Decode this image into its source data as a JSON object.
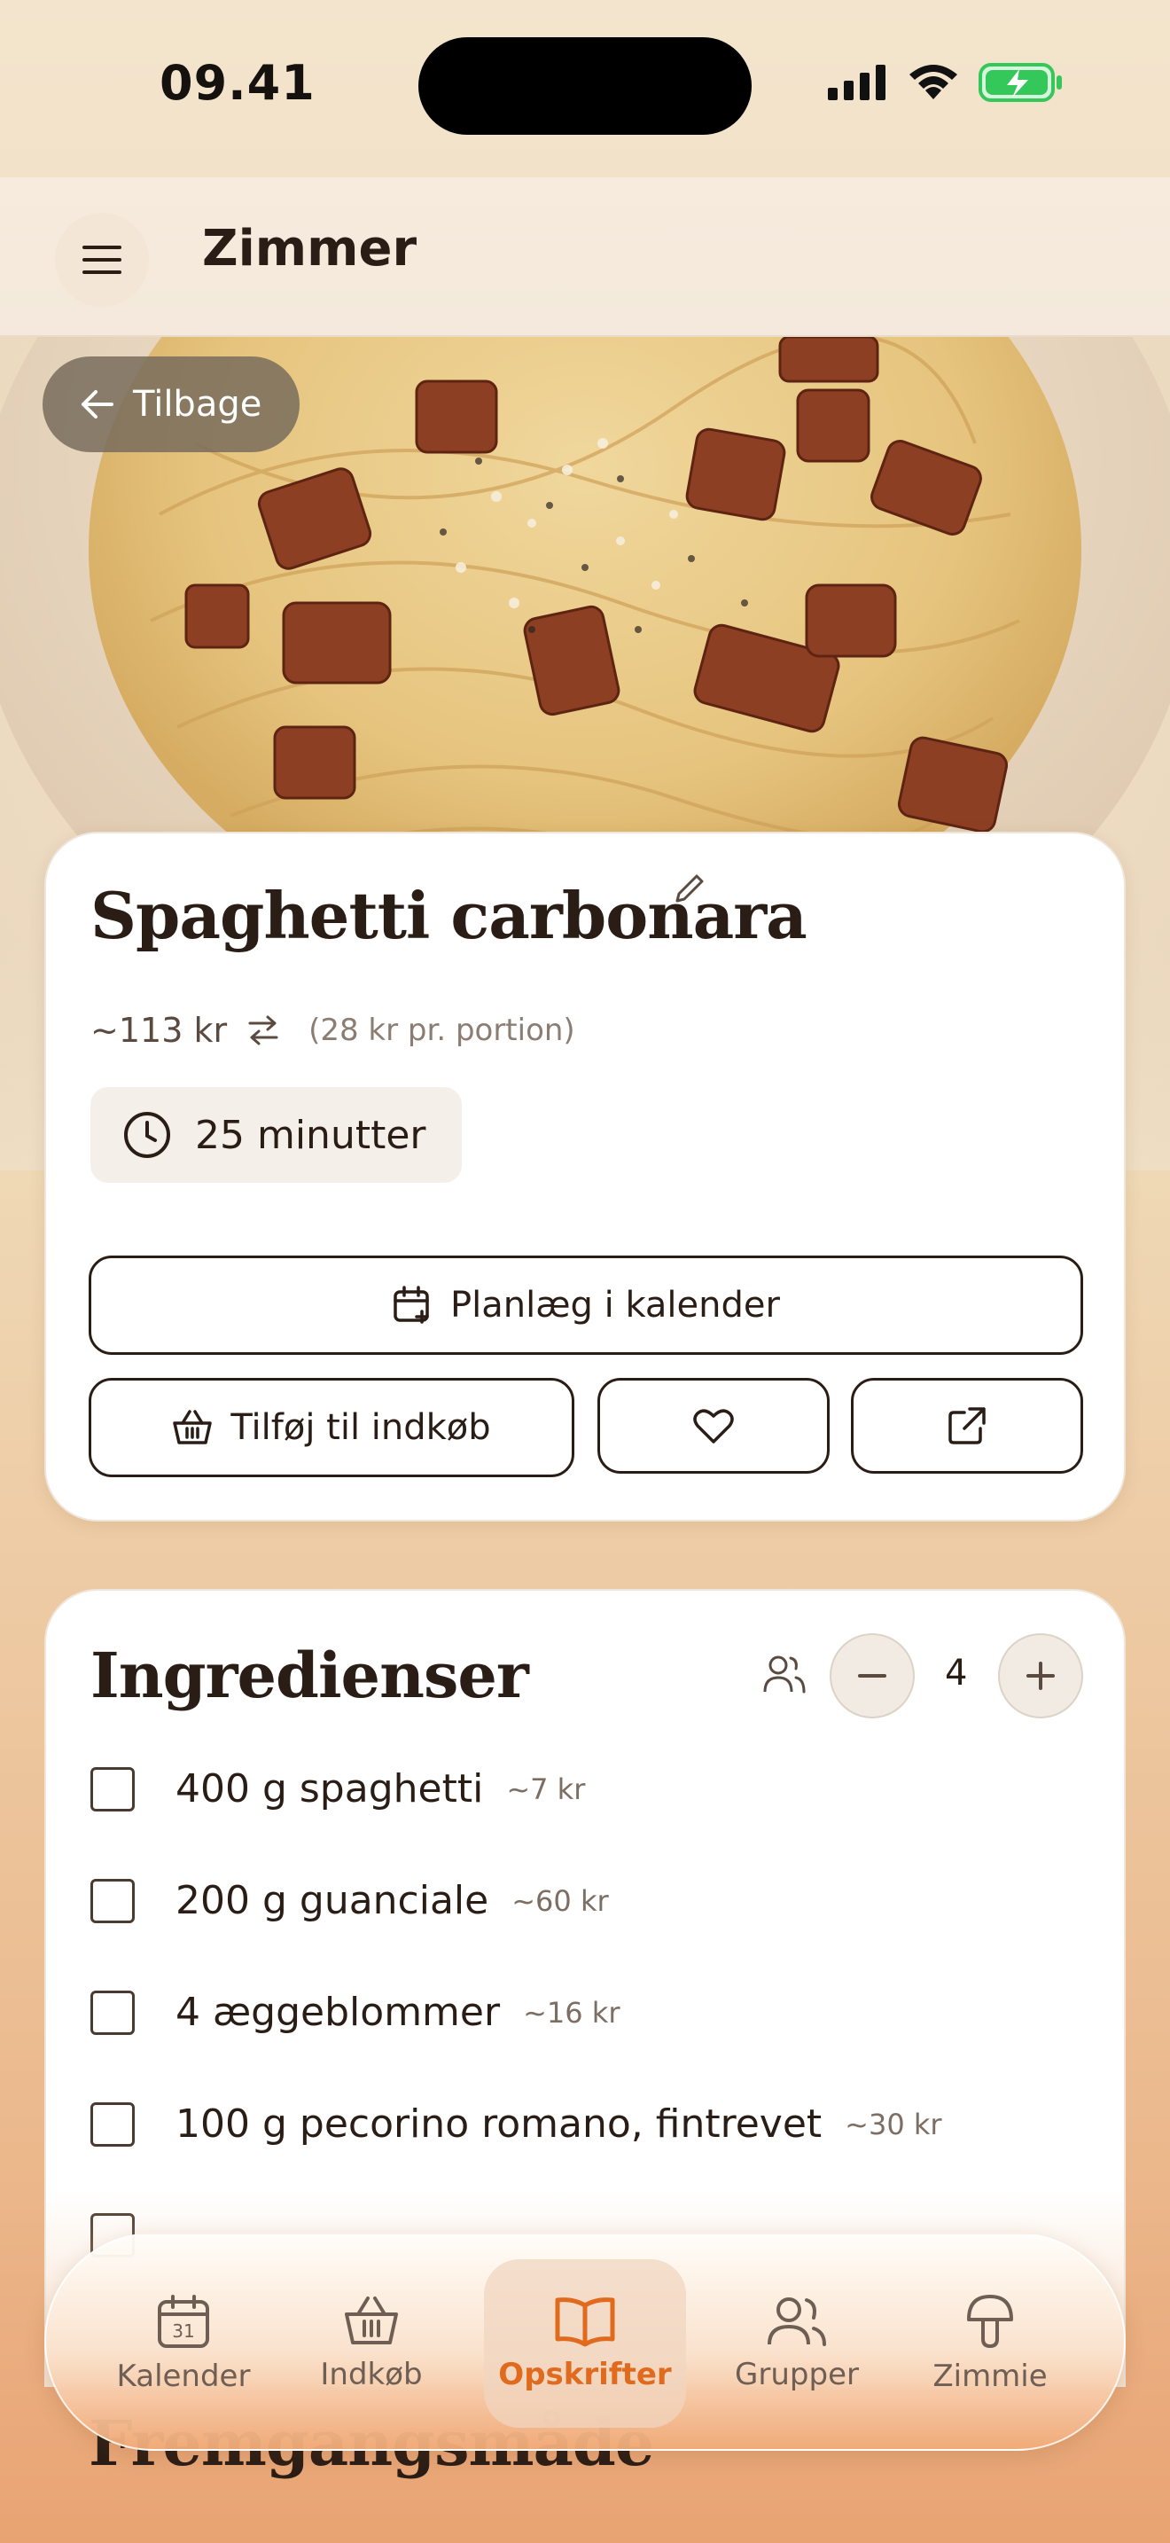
{
  "status_bar": {
    "time": "09.41"
  },
  "header": {
    "title": "Zimmer",
    "menu_icon": "hamburger-icon"
  },
  "hero": {
    "image": "spaghetti-carbonara-photo",
    "back_label": "Tilbage"
  },
  "recipe": {
    "title": "Spaghetti carbonara",
    "price": "~113 kr",
    "per_portion": "(28 kr pr. portion)",
    "time": "25 minutter",
    "plan_label": "Planlæg i kalender",
    "shop_label": "Tilføj til indkøb"
  },
  "ingredients": {
    "title": "Ingredienser",
    "servings": "4",
    "items": [
      {
        "name": "400 g spaghetti",
        "price": "~7 kr"
      },
      {
        "name": "200 g guanciale",
        "price": "~60 kr"
      },
      {
        "name": "4 æggeblommer",
        "price": "~16 kr"
      },
      {
        "name": "100 g pecorino romano, fintrevet",
        "price": "~30 kr"
      }
    ]
  },
  "next_section": {
    "title": "Fremgangsmåde"
  },
  "tabbar": {
    "tabs": [
      {
        "label": "Kalender",
        "icon": "calendar-icon",
        "badge": "31"
      },
      {
        "label": "Indkøb",
        "icon": "basket-icon"
      },
      {
        "label": "Opskrifter",
        "icon": "book-icon",
        "active": true
      },
      {
        "label": "Grupper",
        "icon": "users-icon"
      },
      {
        "label": "Zimmie",
        "icon": "mushroom-icon"
      }
    ]
  },
  "colors": {
    "accent": "#e06a1e",
    "text": "#2a1d16",
    "battery": "#34c759"
  }
}
